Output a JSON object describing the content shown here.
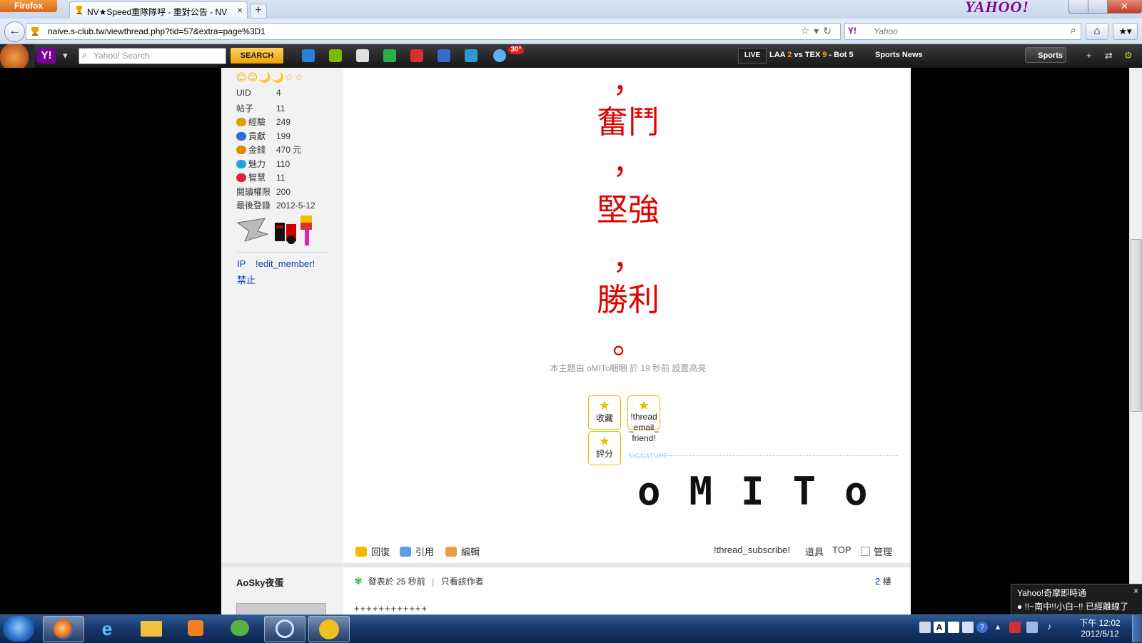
{
  "browser": {
    "app_button": "Firefox",
    "tab_title": "NV★Speed重隊隊呼 - 重對公告 - NV★...",
    "tab_close": "×",
    "new_tab": "+",
    "brand": "YAHOO!",
    "url": "naive.s-club.tw/viewthread.php?tid=57&extra=page%3D1",
    "search_engine": "Y!",
    "search_placeholder": "Yahoo",
    "close_glyph": "✕"
  },
  "yahoo_toolbar": {
    "logo": "Y!",
    "search_placeholder": "Yahoo! Search",
    "search_button": "SEARCH",
    "weather_temp": "30°",
    "live_label": "LIVE",
    "score": {
      "team1": "LAA",
      "score1": "2",
      "vs": "vs",
      "team2": "TEX",
      "score2": "9",
      "inning": "- Bot 5"
    },
    "news_label": "Sports News",
    "sports_button": "Sports"
  },
  "sidebar": {
    "stars": "😊😊🌙🌙☆☆",
    "stats": [
      {
        "label": "UID",
        "value": "4"
      },
      {
        "label": "帖子",
        "value": "11"
      },
      {
        "label": "經驗",
        "value": "249",
        "color": "#d9a000"
      },
      {
        "label": "貢獻",
        "value": "199",
        "color": "#2a6fd6"
      },
      {
        "label": "金錢",
        "value": "470 元",
        "color": "#e08a00"
      },
      {
        "label": "魅力",
        "value": "110",
        "color": "#1fa0e0"
      },
      {
        "label": "智慧",
        "value": "11",
        "color": "#e02040"
      },
      {
        "label": "閱讀權限",
        "value": "200"
      },
      {
        "label": "最後登錄",
        "value": "2012-5-12"
      }
    ],
    "links": {
      "ip": "IP",
      "edit": "!edit_member!",
      "ban": "禁止"
    }
  },
  "post": {
    "lines": [
      "，",
      "奮鬥",
      "，",
      "堅強",
      "，",
      "勝利",
      "。"
    ],
    "highlight_note": "本主題由 oMITo睏睏 於 19 秒前 設置高亮",
    "buttons": {
      "favorite": "收藏",
      "rate": "評分",
      "email": "!thread_email_friend!"
    },
    "signature_label": "SIGNATURE",
    "signature_text": "oMITo",
    "actions": {
      "reply": "回復",
      "quote": "引用",
      "edit": "編輯",
      "subscribe": "!thread_subscribe!",
      "tools": "道具",
      "top": "TOP",
      "manage": "管理"
    }
  },
  "post2": {
    "author": "AoSky夜蛋",
    "meta": "發表於 25 秒前",
    "sep": "|",
    "only_author": "只看該作者",
    "floor_num": "2",
    "floor_suffix": "樓",
    "body": "++++++++++++"
  },
  "notification": {
    "title": "Yahoo!奇摩即時通",
    "message": "!!~南中!!小白~!! 已經離線了",
    "close": "×"
  },
  "taskbar": {
    "time": "下午 12:02",
    "date": "2012/5/12"
  },
  "colors": {
    "accent_red": "#e00000",
    "link_blue": "#0b3cb5",
    "yahoo_purple": "#7b0099"
  }
}
